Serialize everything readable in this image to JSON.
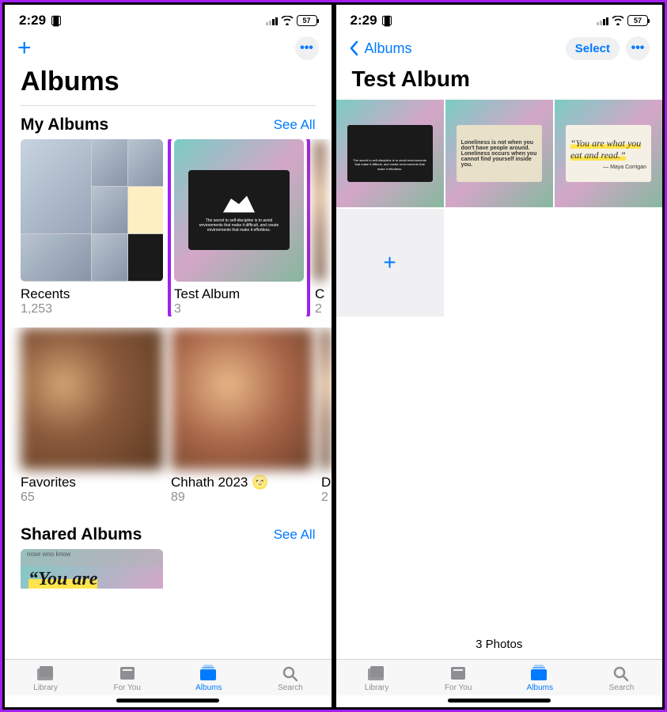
{
  "status": {
    "time": "2:29",
    "battery": "57"
  },
  "left": {
    "title": "Albums",
    "sections": {
      "my_albums": {
        "name": "My Albums",
        "see_all": "See All",
        "items": [
          {
            "label": "Recents",
            "count": "1,253"
          },
          {
            "label": "Test Album",
            "count": "3"
          },
          {
            "label_peek": "C",
            "count_peek": "2"
          },
          {
            "label": "Favorites",
            "count": "65"
          },
          {
            "label": "Chhath 2023 🌝",
            "count": "89"
          },
          {
            "label_peek": "D",
            "count_peek": "2"
          }
        ]
      },
      "shared": {
        "name": "Shared Albums",
        "see_all": "See All",
        "peek_text": "“You are"
      }
    }
  },
  "right": {
    "back": "Albums",
    "select": "Select",
    "title": "Test Album",
    "footer": "3 Photos",
    "photos": [
      {
        "kind": "dark_quote",
        "text": "The secret to self-discipline is to avoid environments that make it difficult, and create environments that make it effortless."
      },
      {
        "kind": "beige_quote",
        "text": "Loneliness is not when you don't have people around. Loneliness occurs when you cannot find yourself inside you."
      },
      {
        "kind": "cream_quote",
        "text": "“You are what you eat and read.”",
        "author": "— Maya Corrigan"
      }
    ]
  },
  "tabs": {
    "library": "Library",
    "for_you": "For You",
    "albums": "Albums",
    "search": "Search"
  }
}
